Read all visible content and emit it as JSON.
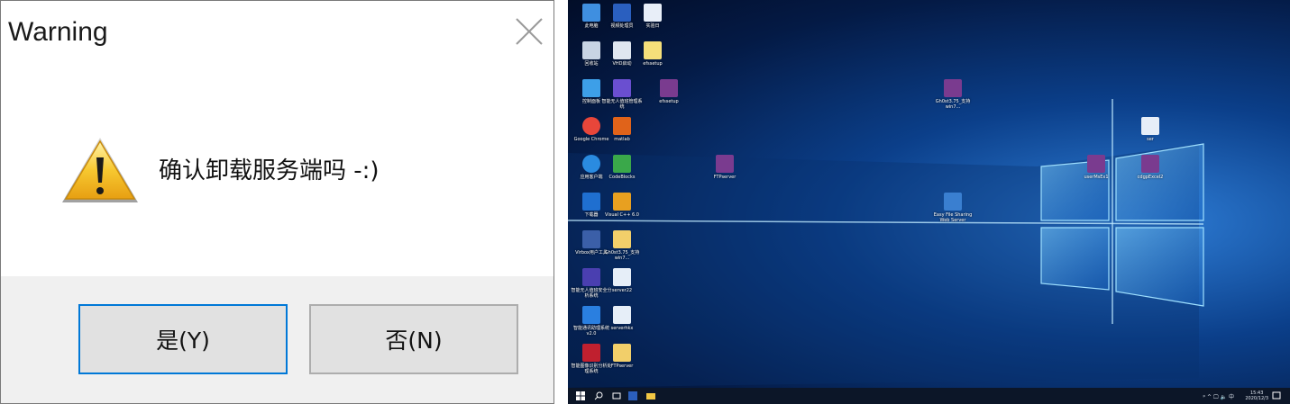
{
  "dialog": {
    "title": "Warning",
    "message": "确认卸载服务端吗 -:)",
    "icon": "warning-triangle-icon",
    "yes_label": "是(Y)",
    "no_label": "否(N)"
  },
  "desktop": {
    "icons": [
      {
        "label": "此电脑"
      },
      {
        "label": "视频处理员"
      },
      {
        "label": "实验日"
      },
      {
        "label": "回收站"
      },
      {
        "label": "VHD启动"
      },
      {
        "label": "efssetup"
      },
      {
        "label": "控制面板"
      },
      {
        "label": "智能无人值班管理系统"
      },
      {
        "label": "efssetup"
      },
      {
        "label": "Google Chrome"
      },
      {
        "label": "matlab"
      },
      {
        "label": "应用客户端"
      },
      {
        "label": "CodeBlocks"
      },
      {
        "label": "下载器"
      },
      {
        "label": "Visual C++ 6.0"
      },
      {
        "label": "Virbox用户工具"
      },
      {
        "label": "Gh0st3.75_支持win7..."
      },
      {
        "label": "智能无人值班安全分析系统"
      },
      {
        "label": "server22"
      },
      {
        "label": "智能通讯助理系统v2.0"
      },
      {
        "label": "serverhkx"
      },
      {
        "label": "智能图像识别分析处理系统"
      },
      {
        "label": "FTPserver"
      },
      {
        "label": "FTPserver"
      },
      {
        "label": "Gh0st3.75_支持win7..."
      },
      {
        "label": "Easy File Sharing Web Server"
      },
      {
        "label": "ser"
      },
      {
        "label": "userMsEx1"
      },
      {
        "label": "cdgpExcel2"
      }
    ],
    "taskbar": {
      "tray_icons": "ᵖ ^ 🖵 🔈 中",
      "time": "15:43",
      "date": "2020/12/3"
    },
    "colors": {
      "wallpaper": "#0b3f8a",
      "light": "#6fc8ff",
      "taskbar": "#0c1628"
    }
  }
}
